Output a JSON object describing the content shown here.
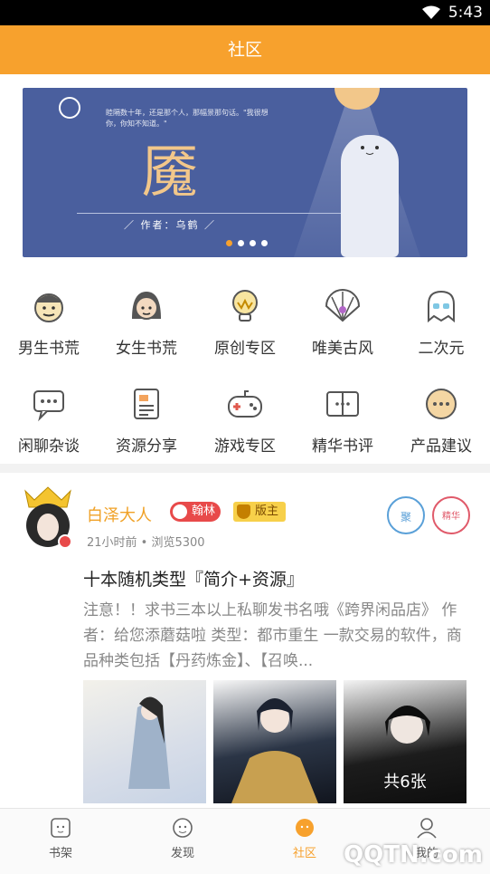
{
  "status_bar": {
    "time": "5:43"
  },
  "header": {
    "title": "社区"
  },
  "banner": {
    "quote": "睦隔数十年，还是那个人，那幅景那句话。\"我很想你，你知不知道。\"",
    "title": "魇",
    "author": "／ 作者：乌鹤 ／",
    "dots": 4,
    "active_dot": 0
  },
  "categories": [
    {
      "label": "男生书荒",
      "icon": "boy-face-icon"
    },
    {
      "label": "女生书荒",
      "icon": "girl-face-icon"
    },
    {
      "label": "原创专区",
      "icon": "lightbulb-icon"
    },
    {
      "label": "唯美古风",
      "icon": "fan-icon"
    },
    {
      "label": "二次元",
      "icon": "ghost-icon"
    },
    {
      "label": "闲聊杂谈",
      "icon": "chat-bubble-icon"
    },
    {
      "label": "资源分享",
      "icon": "document-icon"
    },
    {
      "label": "游戏专区",
      "icon": "gamepad-icon"
    },
    {
      "label": "精华书评",
      "icon": "book-icon"
    },
    {
      "label": "产品建议",
      "icon": "message-icon"
    }
  ],
  "post": {
    "username": "白泽大人",
    "badge_rank": "翰林",
    "badge_role": "版主",
    "stamp_1": "聚",
    "stamp_2": "精华",
    "meta": "21小时前 • 浏览5300",
    "title": "十本随机类型『简介+资源』",
    "excerpt": "注意！！求书三本以上私聊发书名哦《跨界闲品店》 作者：给您添蘑菇啦 类型：都市重生 一款交易的软件，商品种类包括【丹药炼金】、【召唤...",
    "image_count_label": "共6张"
  },
  "tabbar": {
    "tabs": [
      {
        "label": "书架",
        "icon": "bookshelf-icon"
      },
      {
        "label": "发现",
        "icon": "discover-icon"
      },
      {
        "label": "社区",
        "icon": "community-icon"
      },
      {
        "label": "我的",
        "icon": "profile-icon"
      }
    ],
    "active_index": 2
  },
  "watermark": "QQTN.com",
  "colors": {
    "accent": "#f7a12d",
    "username": "#f0a126",
    "badge_rank": "#e84a4a",
    "badge_role": "#f7d04a"
  }
}
